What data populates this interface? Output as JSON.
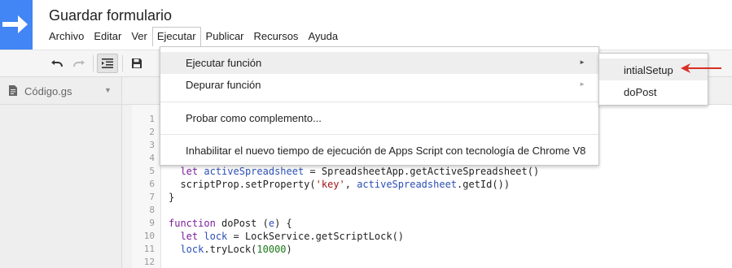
{
  "app": {
    "title": "Guardar formulario",
    "logo_color": "#4285f4"
  },
  "menubar": {
    "items": [
      "Archivo",
      "Editar",
      "Ver",
      "Ejecutar",
      "Publicar",
      "Recursos",
      "Ayuda"
    ],
    "active": "Ejecutar"
  },
  "toolbar": {
    "buttons": [
      {
        "icon": "undo-icon",
        "state": "enabled"
      },
      {
        "icon": "redo-icon",
        "state": "disabled"
      },
      {
        "icon": "indent-icon",
        "state": "pressed"
      },
      {
        "icon": "save-icon",
        "state": "enabled"
      }
    ]
  },
  "sidebar": {
    "file_name": "Código.gs",
    "file_icon": "document-icon"
  },
  "run_menu": {
    "items": [
      {
        "label": "Ejecutar función",
        "has_submenu": true,
        "highlighted": true
      },
      {
        "label": "Depurar función",
        "has_submenu": true,
        "highlighted": false
      },
      {
        "label": "Probar como complemento...",
        "has_submenu": false
      },
      {
        "label": "Inhabilitar el nuevo tiempo de ejecución de Apps Script con tecnología de Chrome V8",
        "has_submenu": false
      }
    ]
  },
  "submenu": {
    "items": [
      "intialSetup",
      "doPost"
    ],
    "highlighted": "intialSetup",
    "annotation_color": "#d93025"
  },
  "editor": {
    "line_numbers": [
      "1",
      "2",
      "3",
      "4",
      "5",
      "6",
      "7",
      "8",
      "9",
      "10",
      "11",
      "12"
    ],
    "visible_lines": [
      {
        "n": "5",
        "text": "  let activeSpreadsheet = SpreadsheetApp.getActiveSpreadsheet()"
      },
      {
        "n": "6",
        "text": "  scriptProp.setProperty('key', activeSpreadsheet.getId())"
      },
      {
        "n": "7",
        "text": "}"
      },
      {
        "n": "9",
        "text": "function doPost (e) {"
      },
      {
        "n": "10",
        "text": "  let lock = LockService.getScriptLock()"
      },
      {
        "n": "11",
        "text": "  lock.tryLock(10000)"
      }
    ]
  }
}
